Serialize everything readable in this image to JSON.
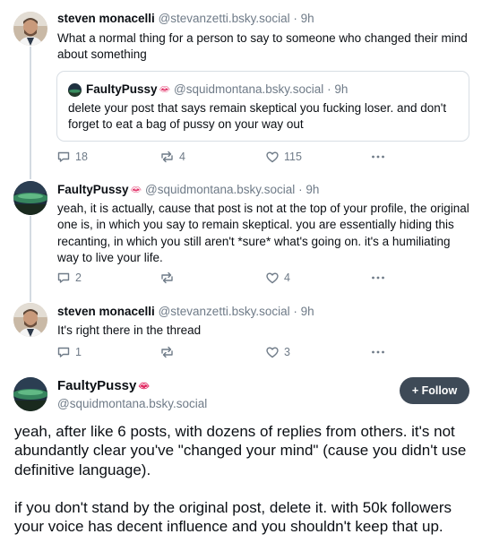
{
  "thread": {
    "posts": [
      {
        "name": "steven monacelli",
        "handle": "@stevanzetti.bsky.social",
        "sep": "·",
        "time": "9h",
        "text": "What a normal thing for a person to say to someone who changed their mind about something",
        "quote": {
          "name": "FaultyPussy",
          "handle": "@squidmontana.bsky.social",
          "sep": "·",
          "time": "9h",
          "text": "delete your post that says remain skeptical you fucking loser. and don't forget to eat a bag of pussy on your way out"
        },
        "replies": "18",
        "reposts": "4",
        "likes": "115"
      },
      {
        "name": "FaultyPussy",
        "handle": "@squidmontana.bsky.social",
        "sep": "·",
        "time": "9h",
        "text": "yeah, it is actually, cause that post is not at the top of your profile, the original one is, in which you say to remain skeptical. you are essentially hiding this recanting, in which you still aren't *sure* what's going on. it's a humiliating way to live your life.",
        "replies": "2",
        "reposts": "",
        "likes": "4"
      },
      {
        "name": "steven monacelli",
        "handle": "@stevanzetti.bsky.social",
        "sep": "·",
        "time": "9h",
        "text": "It's right there in the thread",
        "replies": "1",
        "reposts": "",
        "likes": "3"
      }
    ]
  },
  "main_post": {
    "name": "FaultyPussy",
    "handle": "@squidmontana.bsky.social",
    "follow_label": "+ Follow",
    "paragraph1": "yeah, after like 6 posts, with dozens of replies from others. it's not abundantly clear you've \"changed your mind\" (cause you didn't use definitive language).",
    "paragraph2": "if you don't stand by the original post, delete it. with 50k followers your voice has decent influence and you shouldn't keep that up."
  },
  "icons": {
    "reply": "reply-icon",
    "repost": "repost-icon",
    "like": "heart-icon",
    "more": "more-icon",
    "lips": "lips-emoji"
  },
  "colors": {
    "muted": "#6f7b88",
    "follow_bg": "#3e4a57",
    "lips": "#e0245e"
  }
}
